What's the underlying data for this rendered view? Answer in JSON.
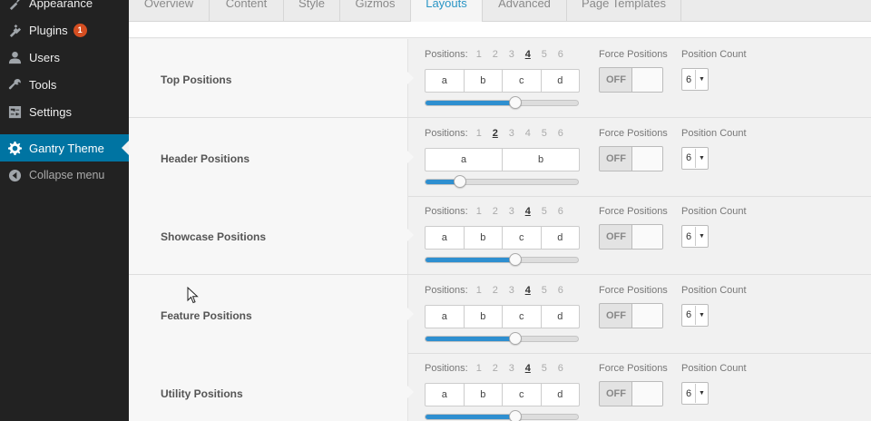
{
  "sidebar": {
    "items": [
      {
        "label": "Appearance",
        "icon": "appearance-icon"
      },
      {
        "label": "Plugins",
        "icon": "plugins-icon",
        "badge": "1"
      },
      {
        "label": "Users",
        "icon": "users-icon"
      },
      {
        "label": "Tools",
        "icon": "tools-icon"
      },
      {
        "label": "Settings",
        "icon": "settings-icon"
      },
      {
        "label": "Gantry Theme",
        "icon": "gear-icon",
        "active": true
      },
      {
        "label": "Collapse menu",
        "icon": "collapse-icon"
      }
    ],
    "active_color": "#0074a2",
    "badge_color": "#d54e21"
  },
  "tabs": [
    {
      "label": "Overview"
    },
    {
      "label": "Content"
    },
    {
      "label": "Style"
    },
    {
      "label": "Gizmos"
    },
    {
      "label": "Layouts",
      "active": true
    },
    {
      "label": "Advanced"
    },
    {
      "label": "Page Templates"
    }
  ],
  "layout_rows": [
    {
      "label": "Top Positions",
      "positions_label": "Positions:",
      "options": [
        "1",
        "2",
        "3",
        "4",
        "5",
        "6"
      ],
      "selected": "4",
      "boxes": [
        "a",
        "b",
        "c",
        "d"
      ],
      "slider_value": 4,
      "force_label": "Force Positions",
      "force_state": "OFF",
      "count_label": "Position Count",
      "count_value": "6"
    },
    {
      "label": "Header Positions",
      "positions_label": "Positions:",
      "options": [
        "1",
        "2",
        "3",
        "4",
        "5",
        "6"
      ],
      "selected": "2",
      "boxes": [
        "a",
        "b"
      ],
      "slider_value": 2,
      "force_label": "Force Positions",
      "force_state": "OFF",
      "count_label": "Position Count",
      "count_value": "6"
    },
    {
      "label": "Showcase Positions",
      "positions_label": "Positions:",
      "options": [
        "1",
        "2",
        "3",
        "4",
        "5",
        "6"
      ],
      "selected": "4",
      "boxes": [
        "a",
        "b",
        "c",
        "d"
      ],
      "slider_value": 4,
      "force_label": "Force Positions",
      "force_state": "OFF",
      "count_label": "Position Count",
      "count_value": "6"
    },
    {
      "label": "Feature Positions",
      "positions_label": "Positions:",
      "options": [
        "1",
        "2",
        "3",
        "4",
        "5",
        "6"
      ],
      "selected": "4",
      "boxes": [
        "a",
        "b",
        "c",
        "d"
      ],
      "slider_value": 4,
      "force_label": "Force Positions",
      "force_state": "OFF",
      "count_label": "Position Count",
      "count_value": "6"
    },
    {
      "label": "Utility Positions",
      "positions_label": "Positions:",
      "options": [
        "1",
        "2",
        "3",
        "4",
        "5",
        "6"
      ],
      "selected": "4",
      "boxes": [
        "a",
        "b",
        "c",
        "d"
      ],
      "slider_value": 4,
      "force_label": "Force Positions",
      "force_state": "OFF",
      "count_label": "Position Count",
      "count_value": "6"
    }
  ],
  "slider_color": "#2e8fd0"
}
